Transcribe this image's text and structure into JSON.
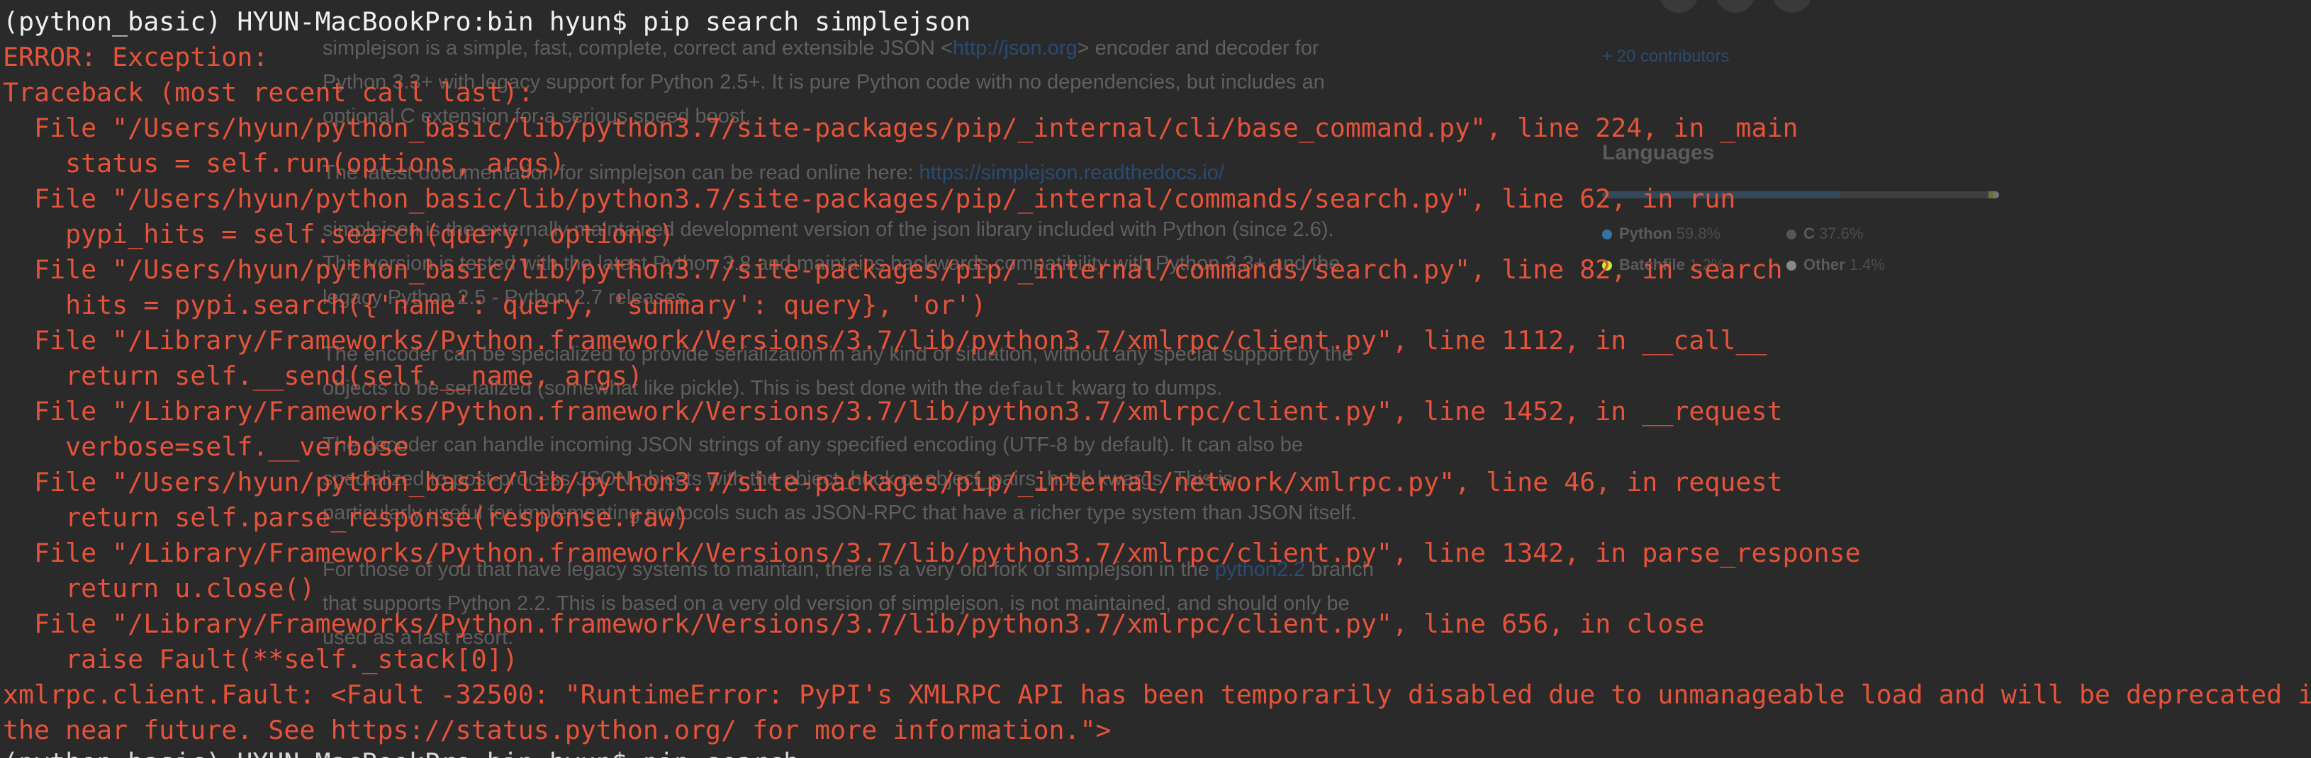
{
  "background_page": {
    "description_paragraphs": [
      {
        "id": "p1",
        "text": "simplejson is a simple, fast, complete, correct and extensible JSON <",
        "link": "http://json.org",
        "after": "> encoder and decoder for"
      },
      {
        "id": "p1b",
        "text": "Python 3.3+ with legacy support for Python 2.5+. It is pure Python code with no dependencies, but includes an"
      },
      {
        "id": "p1c",
        "text": "optional C extension for a serious speed boost."
      },
      {
        "id": "p2",
        "text": "The latest documentation for simplejson can be read online here: ",
        "link": "https://simplejson.readthedocs.io/"
      },
      {
        "id": "p3",
        "text": "simplejson is the externally maintained development version of the json library included with Python (since 2.6)."
      },
      {
        "id": "p3b",
        "text": "This version is tested with the latest Python 3.8 and maintains backwards compatibility with Python 3.3+ and the"
      },
      {
        "id": "p3c",
        "text": "legacy Python 2.5 - Python 2.7 releases."
      },
      {
        "id": "p4",
        "text": "The encoder can be specialized to provide serialization in any kind of situation, without any special support by the"
      },
      {
        "id": "p4b",
        "text": "objects to be serialized (somewhat like pickle). This is best done with the ",
        "code": "default",
        "after": " kwarg to dumps."
      },
      {
        "id": "p5",
        "text": "The decoder can handle incoming JSON strings of any specified encoding (UTF-8 by default). It can also be"
      },
      {
        "id": "p5b",
        "text": "specialized to post-process JSON objects with the object_hook or object_pairs_hook kwargs. This is"
      },
      {
        "id": "p5c",
        "text": "particularly useful for implementing protocols such as JSON-RPC that have a richer type system than JSON itself."
      },
      {
        "id": "p6",
        "text": "For those of you that have legacy systems to maintain, there is a very old fork of simplejson in the ",
        "link": "python2.2",
        "after": " branch"
      },
      {
        "id": "p6b",
        "text": "that supports Python 2.2. This is based on a very old version of simplejson, is not maintained, and should only be"
      },
      {
        "id": "p6c",
        "text": "used as a last resort."
      }
    ],
    "sidebar": {
      "contributors_link": "+ 20 contributors",
      "languages_heading": "Languages",
      "languages": [
        {
          "name": "Python",
          "percent": "59.8%",
          "share": 0.598,
          "color": "#3572A5"
        },
        {
          "name": "C",
          "percent": "37.6%",
          "share": 0.376,
          "color": "#555555"
        },
        {
          "name": "Batchfile",
          "percent": "1.2%",
          "share": 0.012,
          "color": "#C1F12E"
        },
        {
          "name": "Other",
          "percent": "1.4%",
          "share": 0.014,
          "color": "#ededed"
        }
      ]
    }
  },
  "terminal": {
    "lines": [
      {
        "id": "cmd",
        "style": "prompt",
        "text": "(python_basic) HYUN-MacBookPro:bin hyun$ pip search simplejson"
      },
      {
        "id": "e1",
        "style": "err",
        "text": "ERROR: Exception:"
      },
      {
        "id": "e2",
        "style": "err",
        "text": "Traceback (most recent call last):"
      },
      {
        "id": "e3",
        "style": "err",
        "text": "  File \"/Users/hyun/python_basic/lib/python3.7/site-packages/pip/_internal/cli/base_command.py\", line 224, in _main"
      },
      {
        "id": "e4",
        "style": "err",
        "text": "    status = self.run(options, args)"
      },
      {
        "id": "e5",
        "style": "err",
        "text": "  File \"/Users/hyun/python_basic/lib/python3.7/site-packages/pip/_internal/commands/search.py\", line 62, in run"
      },
      {
        "id": "e6",
        "style": "err",
        "text": "    pypi_hits = self.search(query, options)"
      },
      {
        "id": "e7",
        "style": "err",
        "text": "  File \"/Users/hyun/python_basic/lib/python3.7/site-packages/pip/_internal/commands/search.py\", line 82, in search"
      },
      {
        "id": "e8",
        "style": "err",
        "text": "    hits = pypi.search({'name': query, 'summary': query}, 'or')"
      },
      {
        "id": "e9",
        "style": "err",
        "text": "  File \"/Library/Frameworks/Python.framework/Versions/3.7/lib/python3.7/xmlrpc/client.py\", line 1112, in __call__"
      },
      {
        "id": "e10",
        "style": "err",
        "text": "    return self.__send(self.__name, args)"
      },
      {
        "id": "e11",
        "style": "err",
        "text": "  File \"/Library/Frameworks/Python.framework/Versions/3.7/lib/python3.7/xmlrpc/client.py\", line 1452, in __request"
      },
      {
        "id": "e12",
        "style": "err",
        "text": "    verbose=self.__verbose"
      },
      {
        "id": "e13",
        "style": "err",
        "text": "  File \"/Users/hyun/python_basic/lib/python3.7/site-packages/pip/_internal/network/xmlrpc.py\", line 46, in request"
      },
      {
        "id": "e14",
        "style": "err",
        "text": "    return self.parse_response(response.raw)"
      },
      {
        "id": "e15",
        "style": "err",
        "text": "  File \"/Library/Frameworks/Python.framework/Versions/3.7/lib/python3.7/xmlrpc/client.py\", line 1342, in parse_response"
      },
      {
        "id": "e16",
        "style": "err",
        "text": "    return u.close()"
      },
      {
        "id": "e17",
        "style": "err",
        "text": "  File \"/Library/Frameworks/Python.framework/Versions/3.7/lib/python3.7/xmlrpc/client.py\", line 656, in close"
      },
      {
        "id": "e18",
        "style": "err",
        "text": "    raise Fault(**self._stack[0])"
      },
      {
        "id": "e19",
        "style": "err",
        "text": "xmlrpc.client.Fault: <Fault -32500: \"RuntimeError: PyPI's XMLRPC API has been temporarily disabled due to unmanageable load and will be deprecated in"
      },
      {
        "id": "e20",
        "style": "err",
        "text": "the near future. See https://status.python.org/ for more information.\">"
      },
      {
        "id": "next",
        "style": "partial",
        "text": "(python_basic) HYUN-MacBookPro:bin hyun$ pip search"
      }
    ]
  },
  "colors": {
    "terminal_bg": "#2a2a2a",
    "error_text": "#e4533a",
    "prompt_text": "#f0f0f0"
  }
}
